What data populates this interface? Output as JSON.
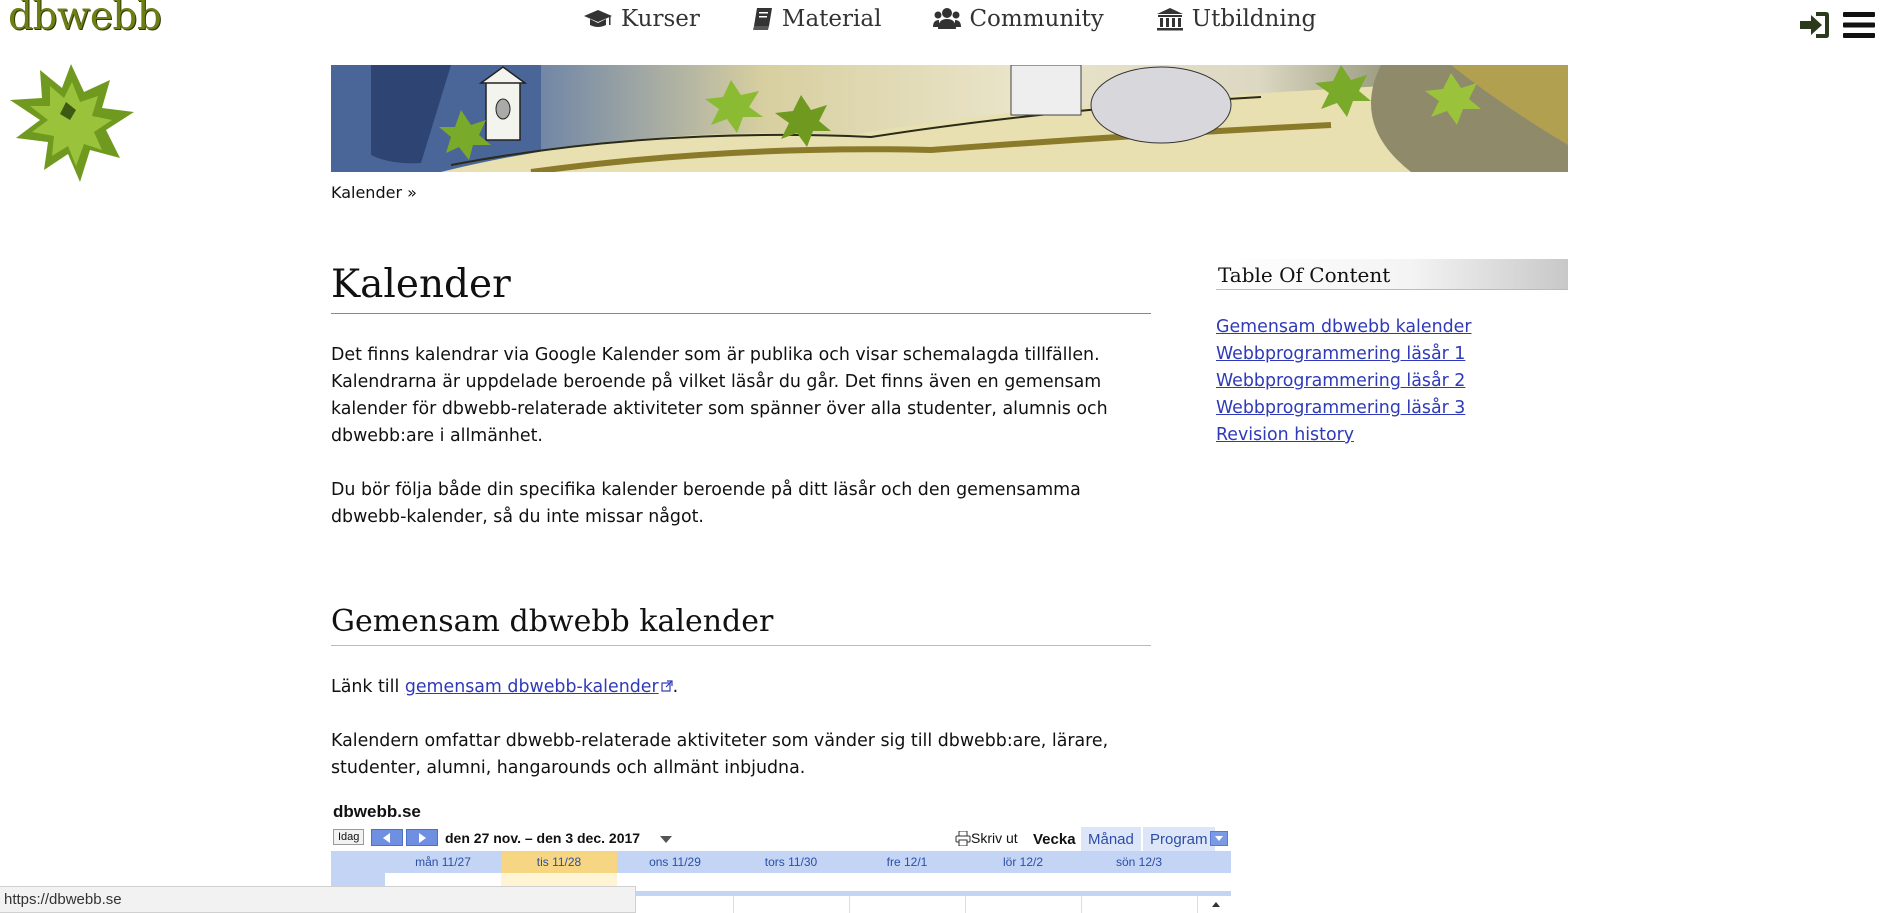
{
  "header": {
    "logo": "dbwebb",
    "nav": [
      {
        "label": "Kurser",
        "icon": "graduation-cap-icon"
      },
      {
        "label": "Material",
        "icon": "book-icon"
      },
      {
        "label": "Community",
        "icon": "users-icon"
      },
      {
        "label": "Utbildning",
        "icon": "institution-icon"
      }
    ],
    "right_icons": [
      "login-icon",
      "menu-icon"
    ]
  },
  "breadcrumb": "Kalender »",
  "main": {
    "title": "Kalender",
    "intro": [
      "Det finns kalendrar via Google Kalender som är publika och visar schemalagda tillfällen. Kalendrarna är uppdelade beroende på vilket läsår du går. Det finns även en gemensam kalender för dbwebb-relaterade aktiviteter som spänner över alla studenter, alumnis och dbwebb:are i allmänhet.",
      "Du bör följa både din specifika kalender beroende på ditt läsår och den gemensamma dbwebb-kalender, så du inte missar något."
    ],
    "section": {
      "title": "Gemensam dbwebb kalender",
      "link_prefix": "Länk till ",
      "link_text": "gemensam dbwebb-kalender",
      "link_suffix": ".",
      "description": "Kalendern omfattar dbwebb-relaterade aktiviteter som vänder sig till dbwebb:are, lärare, studenter, alumni, hangarounds och allmänt inbjudna."
    }
  },
  "calendar": {
    "title": "dbwebb.se",
    "today_button": "Idag",
    "range": "den 27 nov. – den 3 dec. 2017",
    "print": "Skriv ut",
    "tabs": [
      {
        "label": "Vecka",
        "active": true
      },
      {
        "label": "Månad",
        "active": false
      },
      {
        "label": "Program",
        "active": false
      }
    ],
    "days": [
      "mån 11/27",
      "tis 11/28",
      "ons 11/29",
      "tors 11/30",
      "fre 12/1",
      "lör 12/2",
      "sön 12/3"
    ],
    "today_index": 1
  },
  "toc": {
    "title": "Table Of Content",
    "items": [
      "Gemensam dbwebb kalender",
      "Webbprogrammering läsår 1",
      "Webbprogrammering läsår 2",
      "Webbprogrammering läsår 3",
      "Revision history"
    ]
  },
  "status_bar": "https://dbwebb.se",
  "colors": {
    "link": "#2f3ab8",
    "logo": "#6e7d14",
    "calendar_header": "#c3d4f5",
    "calendar_today": "#f6d583"
  }
}
